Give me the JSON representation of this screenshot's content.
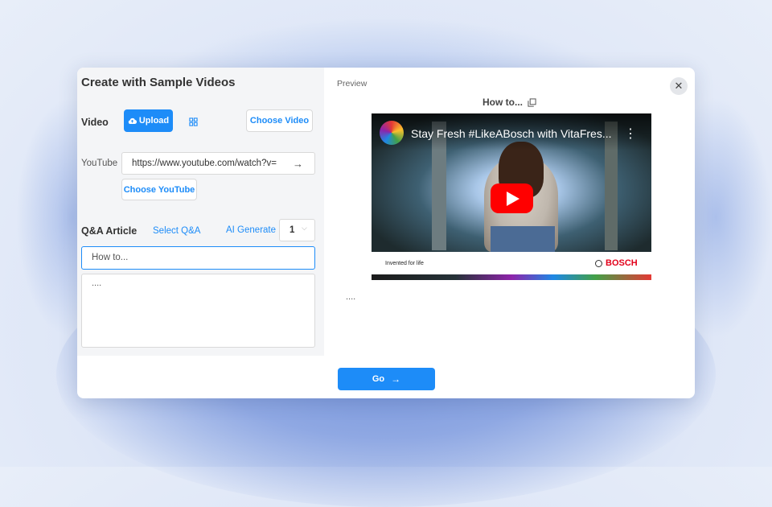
{
  "modal": {
    "title": "Create with Sample Videos",
    "video_label": "Video",
    "upload_label": "Upload",
    "choose_video_label": "Choose Video",
    "youtube_label": "YouTube",
    "youtube_url": "https://www.youtube.com/watch?v=",
    "choose_youtube_label": "Choose YouTube",
    "qa_label": "Q&A Article",
    "select_qa_label": "Select Q&A",
    "ai_generate_label": "AI Generate",
    "count_value": "1",
    "question_value": "How to...",
    "answer_value": "....",
    "go_label": "Go"
  },
  "preview": {
    "label": "Preview",
    "heading": "How to...",
    "video_title": "Stay Fresh #LikeABosch with VitaFres...",
    "tagline": "Invented for life",
    "brand": "BOSCH",
    "answer_text": "...."
  },
  "icons": {
    "upload": "cloud-upload-icon",
    "gallery": "grid-icon",
    "arrow": "arrow-right-icon",
    "dropdown": "chevron-down-icon",
    "close": "close-icon",
    "copy": "copy-icon",
    "play": "play-icon",
    "menu": "more-vertical-icon"
  },
  "colors": {
    "primary": "#1d8cf8",
    "youtube_red": "#ff0000",
    "bosch_red": "#e2001a"
  }
}
